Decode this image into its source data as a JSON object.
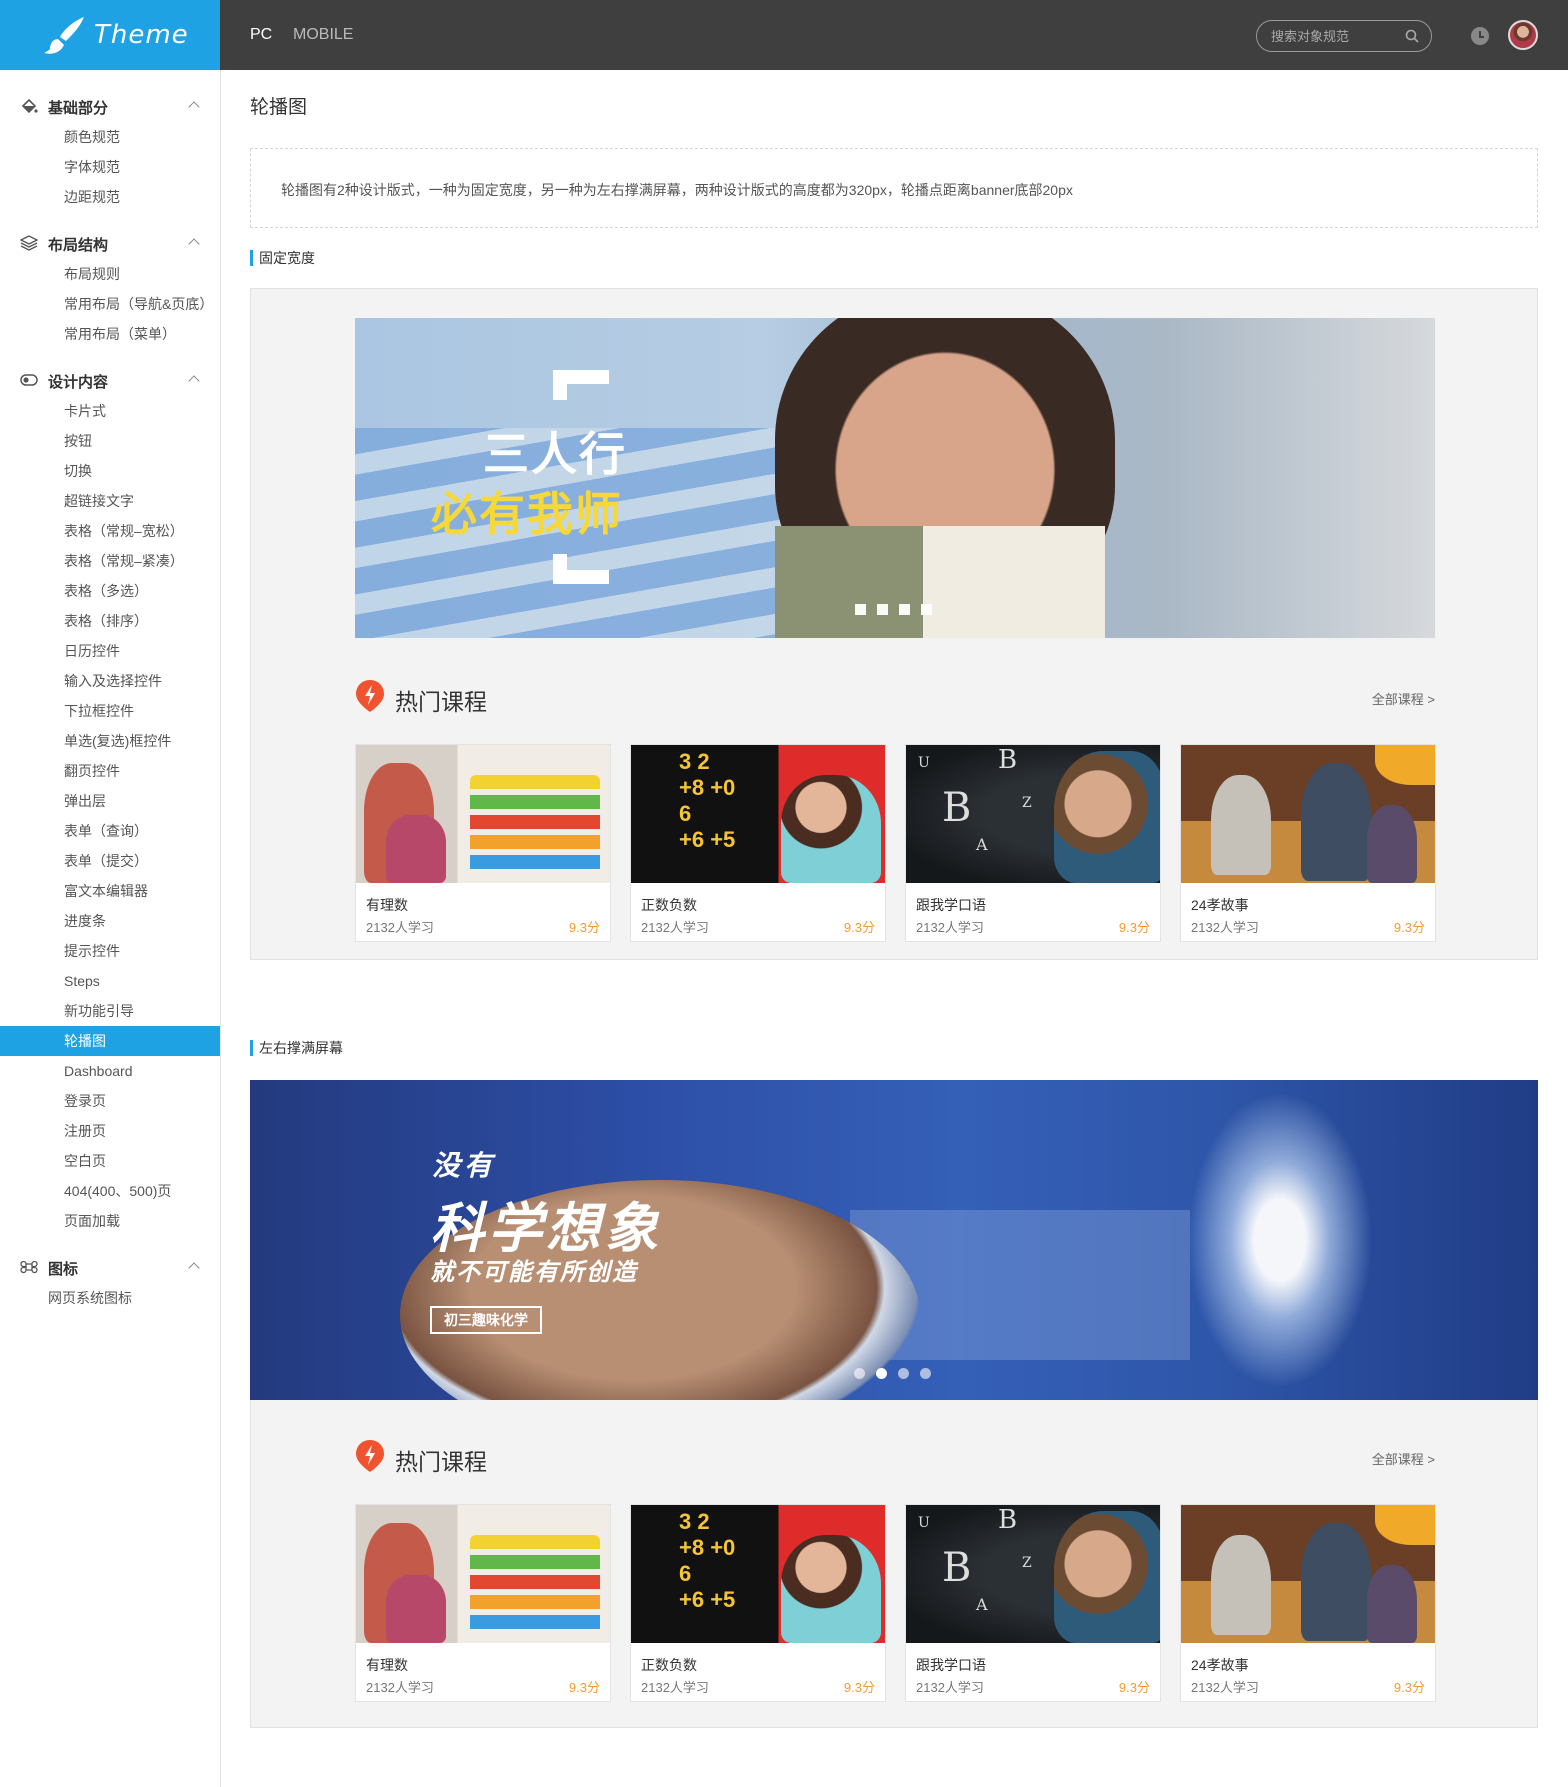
{
  "header": {
    "logo_text": "Theme",
    "tabs": [
      {
        "label": "PC",
        "active": true
      },
      {
        "label": "MOBILE",
        "active": false
      }
    ],
    "search_placeholder": "搜索对象规范"
  },
  "sidebar": {
    "groups": [
      {
        "title": "基础部分",
        "icon": "paint-bucket-icon",
        "items": [
          "颜色规范",
          "字体规范",
          "边距规范"
        ]
      },
      {
        "title": "布局结构",
        "icon": "layers-icon",
        "items": [
          "布局规则",
          "常用布局（导航&页底）",
          "常用布局（菜单）"
        ]
      },
      {
        "title": "设计内容",
        "icon": "toggle-icon",
        "items": [
          "卡片式",
          "按钮",
          "切换",
          "超链接文字",
          "表格（常规–宽松）",
          "表格（常规–紧凑）",
          "表格（多选）",
          "表格（排序）",
          "日历控件",
          "输入及选择控件",
          "下拉框控件",
          "单选(复选)框控件",
          "翻页控件",
          "弹出层",
          "表单（查询）",
          "表单（提交）",
          "富文本编辑器",
          "进度条",
          "提示控件",
          "Steps",
          "新功能引导",
          "轮播图",
          "Dashboard",
          "登录页",
          "注册页",
          "空白页",
          "404(400、500)页",
          "页面加载"
        ]
      },
      {
        "title": "图标",
        "icon": "command-icon",
        "items": [
          "网页系统图标"
        ]
      }
    ],
    "active_item": "轮播图"
  },
  "main": {
    "title": "轮播图",
    "notice": "轮播图有2种设计版式，一种为固定宽度，另一种为左右撑满屏幕，两种设计版式的高度都为320px，轮播点距离banner底部20px",
    "sections": [
      {
        "label": "固定宽度",
        "banner": {
          "line1": "三人行",
          "line2": "必有我师",
          "dots": 4,
          "active_dot": 0
        }
      },
      {
        "label": "左右撑满屏幕",
        "banner": {
          "line1": "没有",
          "line2": "科学想象",
          "line3": "就不可能有所创造",
          "tag": "初三趣味化学",
          "dots": 4,
          "active_dot": 1
        }
      }
    ],
    "hot": {
      "title": "热门课程",
      "all_link": "全部课程 >"
    },
    "courses": [
      {
        "name": "有理数",
        "learners": "2132人学习",
        "score": "9.3分",
        "image": "abacus"
      },
      {
        "name": "正数负数",
        "learners": "2132人学习",
        "score": "9.3分",
        "image": "blackboard"
      },
      {
        "name": "跟我学口语",
        "learners": "2132人学习",
        "score": "9.3分",
        "image": "letters"
      },
      {
        "name": "24孝故事",
        "learners": "2132人学习",
        "score": "9.3分",
        "image": "story"
      }
    ]
  },
  "colors": {
    "brand": "#1ea2e3",
    "topbar": "#3f3f3f",
    "score": "#f39b2e",
    "hot_icon": "#f0532f"
  }
}
